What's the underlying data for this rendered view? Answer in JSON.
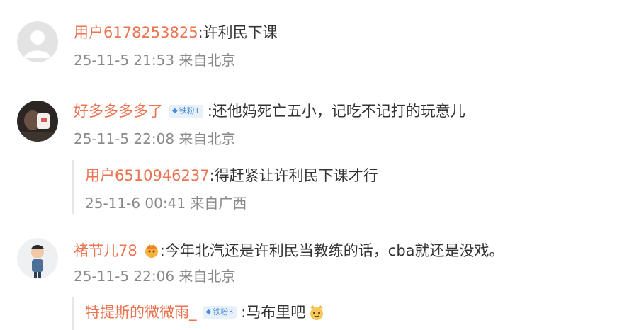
{
  "comments": [
    {
      "username": "用户6178253825",
      "text": ":许利民下课",
      "meta": "25-11-5 21:53 来自北京"
    },
    {
      "username": "好多多多多了",
      "badge": "铁粉1",
      "text": ":还他妈死亡五小，记吃不记打的玩意儿",
      "meta": "25-11-5 22:08 来自北京",
      "reply": {
        "username": "用户6510946237",
        "text": ":得赶紧让许利民下课才行",
        "meta": "25-11-6 00:41 来自广西"
      }
    },
    {
      "username": "褚节儿78",
      "text": ":今年北汽还是许利民当教练的话，cba就还是没戏。",
      "meta": "25-11-5 22:06 来自北京",
      "reply": {
        "username": "特提斯的微微雨_",
        "badge": "铁粉3",
        "text": ":马布里吧"
      }
    }
  ],
  "icons": {
    "badge_arrow": "up-arrow-icon",
    "fan_icon": "fan-crown-icon",
    "emoji": "cat-face-emoji-icon"
  },
  "colors": {
    "username": "#eb7350",
    "text": "#333333",
    "meta": "#8a8a8a",
    "badge_bg": "#e7f0fb",
    "badge_text": "#4a8bd6"
  }
}
